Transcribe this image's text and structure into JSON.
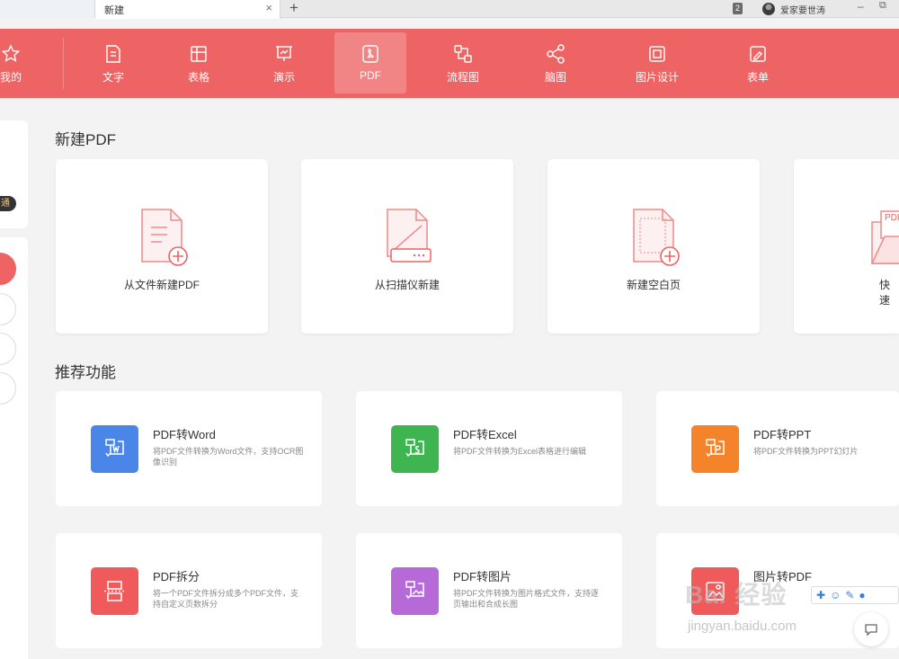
{
  "tabs": {
    "active_label": "新建",
    "close_glyph": "×",
    "add_glyph": "+"
  },
  "titlebar": {
    "window_count": "2",
    "user_name": "爱家要世涛",
    "minimize_glyph": "–",
    "restore_glyph": "⧉"
  },
  "nav": {
    "accent": "#ee6363",
    "items": [
      {
        "label": "我的",
        "icon": "star-icon"
      },
      {
        "label": "文字",
        "icon": "document-icon"
      },
      {
        "label": "表格",
        "icon": "table-icon"
      },
      {
        "label": "演示",
        "icon": "presentation-icon"
      },
      {
        "label": "PDF",
        "icon": "pdf-icon",
        "active": true
      },
      {
        "label": "流程图",
        "icon": "flowchart-icon"
      },
      {
        "label": "脑图",
        "icon": "mindmap-icon"
      },
      {
        "label": "图片设计",
        "icon": "image-design-icon"
      },
      {
        "label": "表单",
        "icon": "form-icon"
      }
    ]
  },
  "sidebar": {
    "badge": "通"
  },
  "new_pdf": {
    "title": "新建PDF",
    "cards": [
      {
        "label": "从文件新建PDF",
        "icon": "file-add-icon"
      },
      {
        "label": "从扫描仪新建",
        "icon": "scanner-icon"
      },
      {
        "label": "新建空白页",
        "icon": "blank-page-add-icon"
      },
      {
        "label": "快速",
        "icon": "pdf-folder-icon",
        "icon_text": "PDF"
      }
    ]
  },
  "recommended": {
    "title": "推荐功能",
    "items": [
      {
        "title": "PDF转Word",
        "desc": "将PDF文件转换为Word文件，支持OCR图像识别",
        "color": "#4a86e8",
        "icon": "pdf-to-word-icon"
      },
      {
        "title": "PDF转Excel",
        "desc": "将PDF文件转换为Excel表格进行编辑",
        "color": "#3fb552",
        "icon": "pdf-to-excel-icon"
      },
      {
        "title": "PDF转PPT",
        "desc": "将PDF文件转换为PPT幻灯片",
        "color": "#f5832a",
        "icon": "pdf-to-ppt-icon"
      },
      {
        "title": "PDF拆分",
        "desc": "将一个PDF文件拆分成多个PDF文件，支持自定义页数拆分",
        "color": "#f05a5a",
        "icon": "pdf-split-icon"
      },
      {
        "title": "PDF转图片",
        "desc": "将PDF文件转换为图片格式文件，支持逐页输出和合成长图",
        "color": "#b56ad8",
        "icon": "pdf-to-image-icon"
      },
      {
        "title": "图片转PDF",
        "desc": "",
        "color": "#f05a5a",
        "icon": "image-to-pdf-icon"
      }
    ]
  },
  "overlay": {
    "watermark": "Bai 经验",
    "watermark_sub": "jingyan.baidu.com"
  }
}
